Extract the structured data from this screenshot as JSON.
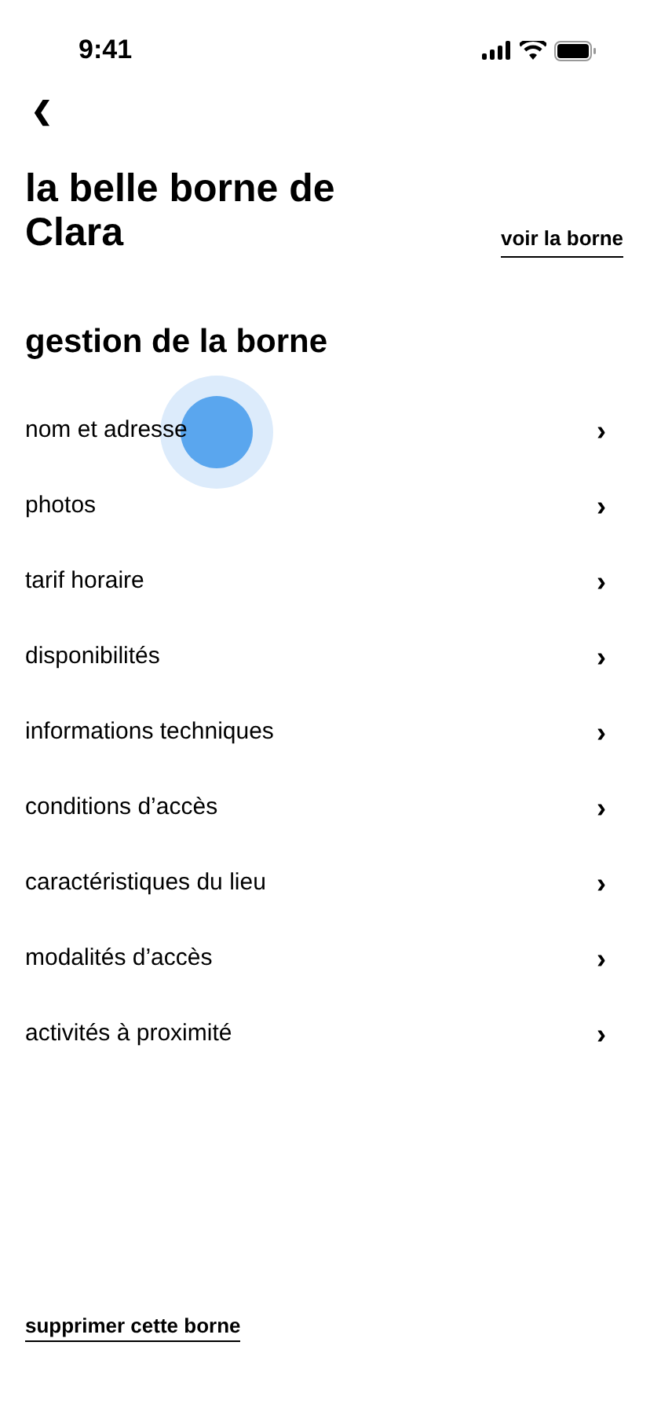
{
  "status_bar": {
    "time": "9:41"
  },
  "header": {
    "back": "❮",
    "title": "la belle borne de Clara",
    "link": "voir la borne"
  },
  "section": {
    "title": "gestion de la borne",
    "chevron": "›"
  },
  "items": [
    {
      "label": "nom et adresse",
      "touched": true
    },
    {
      "label": "photos",
      "touched": false
    },
    {
      "label": "tarif horaire",
      "touched": false
    },
    {
      "label": "disponibilités",
      "touched": false
    },
    {
      "label": "informations techniques",
      "touched": false
    },
    {
      "label": "conditions d’accès",
      "touched": false
    },
    {
      "label": "caractéristiques du lieu",
      "touched": false
    },
    {
      "label": "modalités d’accès",
      "touched": false
    },
    {
      "label": "activités à proximité",
      "touched": false
    }
  ],
  "footer": {
    "link": "supprimer cette borne"
  }
}
